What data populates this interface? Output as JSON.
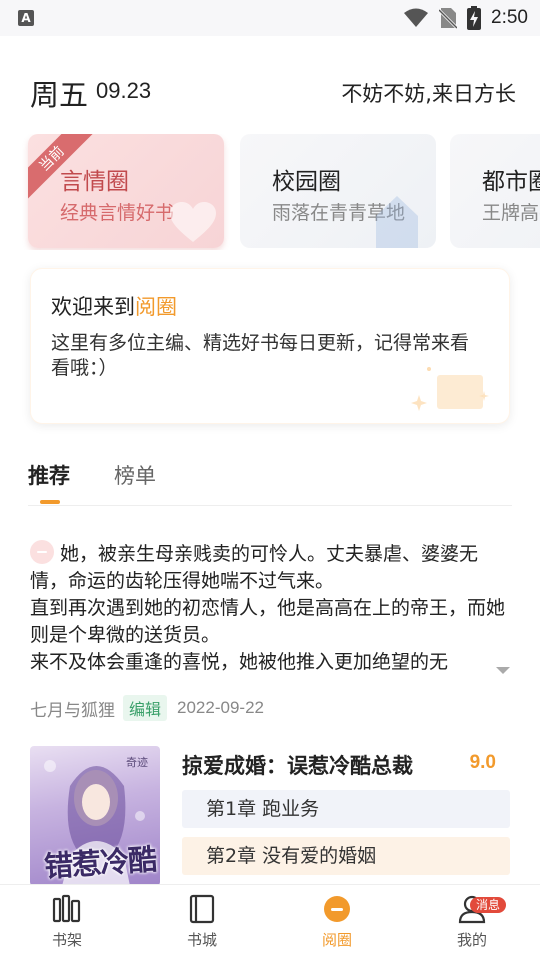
{
  "status_bar": {
    "app_icon_letter": "A",
    "time": "2:50"
  },
  "header": {
    "weekday": "周五",
    "date": "09.23",
    "slogan": "不妨不妨,来日方长"
  },
  "circles": [
    {
      "title": "言情圈",
      "subtitle": "经典言情好书",
      "ribbon": "当前",
      "active": true
    },
    {
      "title": "校园圈",
      "subtitle": "雨落在青青草地",
      "active": false
    },
    {
      "title": "都市圈",
      "subtitle": "王牌高手",
      "active": false
    }
  ],
  "welcome": {
    "title_prefix": "欢迎来到",
    "title_highlight": "阅圈",
    "description": "这里有多位主编、精选好书每日更新，记得常来看看哦：）"
  },
  "tabs": [
    {
      "label": "推荐",
      "active": true
    },
    {
      "label": "榜单",
      "active": false
    }
  ],
  "post": {
    "text": "她，被亲生母亲贱卖的可怜人。丈夫暴虐、婆婆无情，命运的齿轮压得她喘不过气来。\n直到再次遇到她的初恋情人，他是高高在上的帝王，而她则是个卑微的送货员。\n来不及体会重逢的喜悦，她被他推入更加绝望的无",
    "author": "七月与狐狸",
    "badge": "编辑",
    "date": "2022-09-22"
  },
  "book": {
    "title": "掠爱成婚：误惹冷酷总裁",
    "score": "9.0",
    "cover_title": "错惹冷酷",
    "cover_publisher": "奇迹",
    "chapters": [
      {
        "label": "第1章 跑业务"
      },
      {
        "label": "第2章 没有爱的婚姻"
      }
    ]
  },
  "bottom_nav": [
    {
      "label": "书架",
      "icon": "bookshelf-icon",
      "active": false
    },
    {
      "label": "书城",
      "icon": "book-icon",
      "active": false
    },
    {
      "label": "阅圈",
      "icon": "circle-chat-icon",
      "active": true
    },
    {
      "label": "我的",
      "icon": "profile-icon",
      "active": false,
      "badge": "消息"
    }
  ],
  "colors": {
    "accent": "#f29a2c",
    "active_circle_text": "#c14a4d",
    "editor_badge": "#3aa06a",
    "message_badge": "#e24a3b"
  }
}
